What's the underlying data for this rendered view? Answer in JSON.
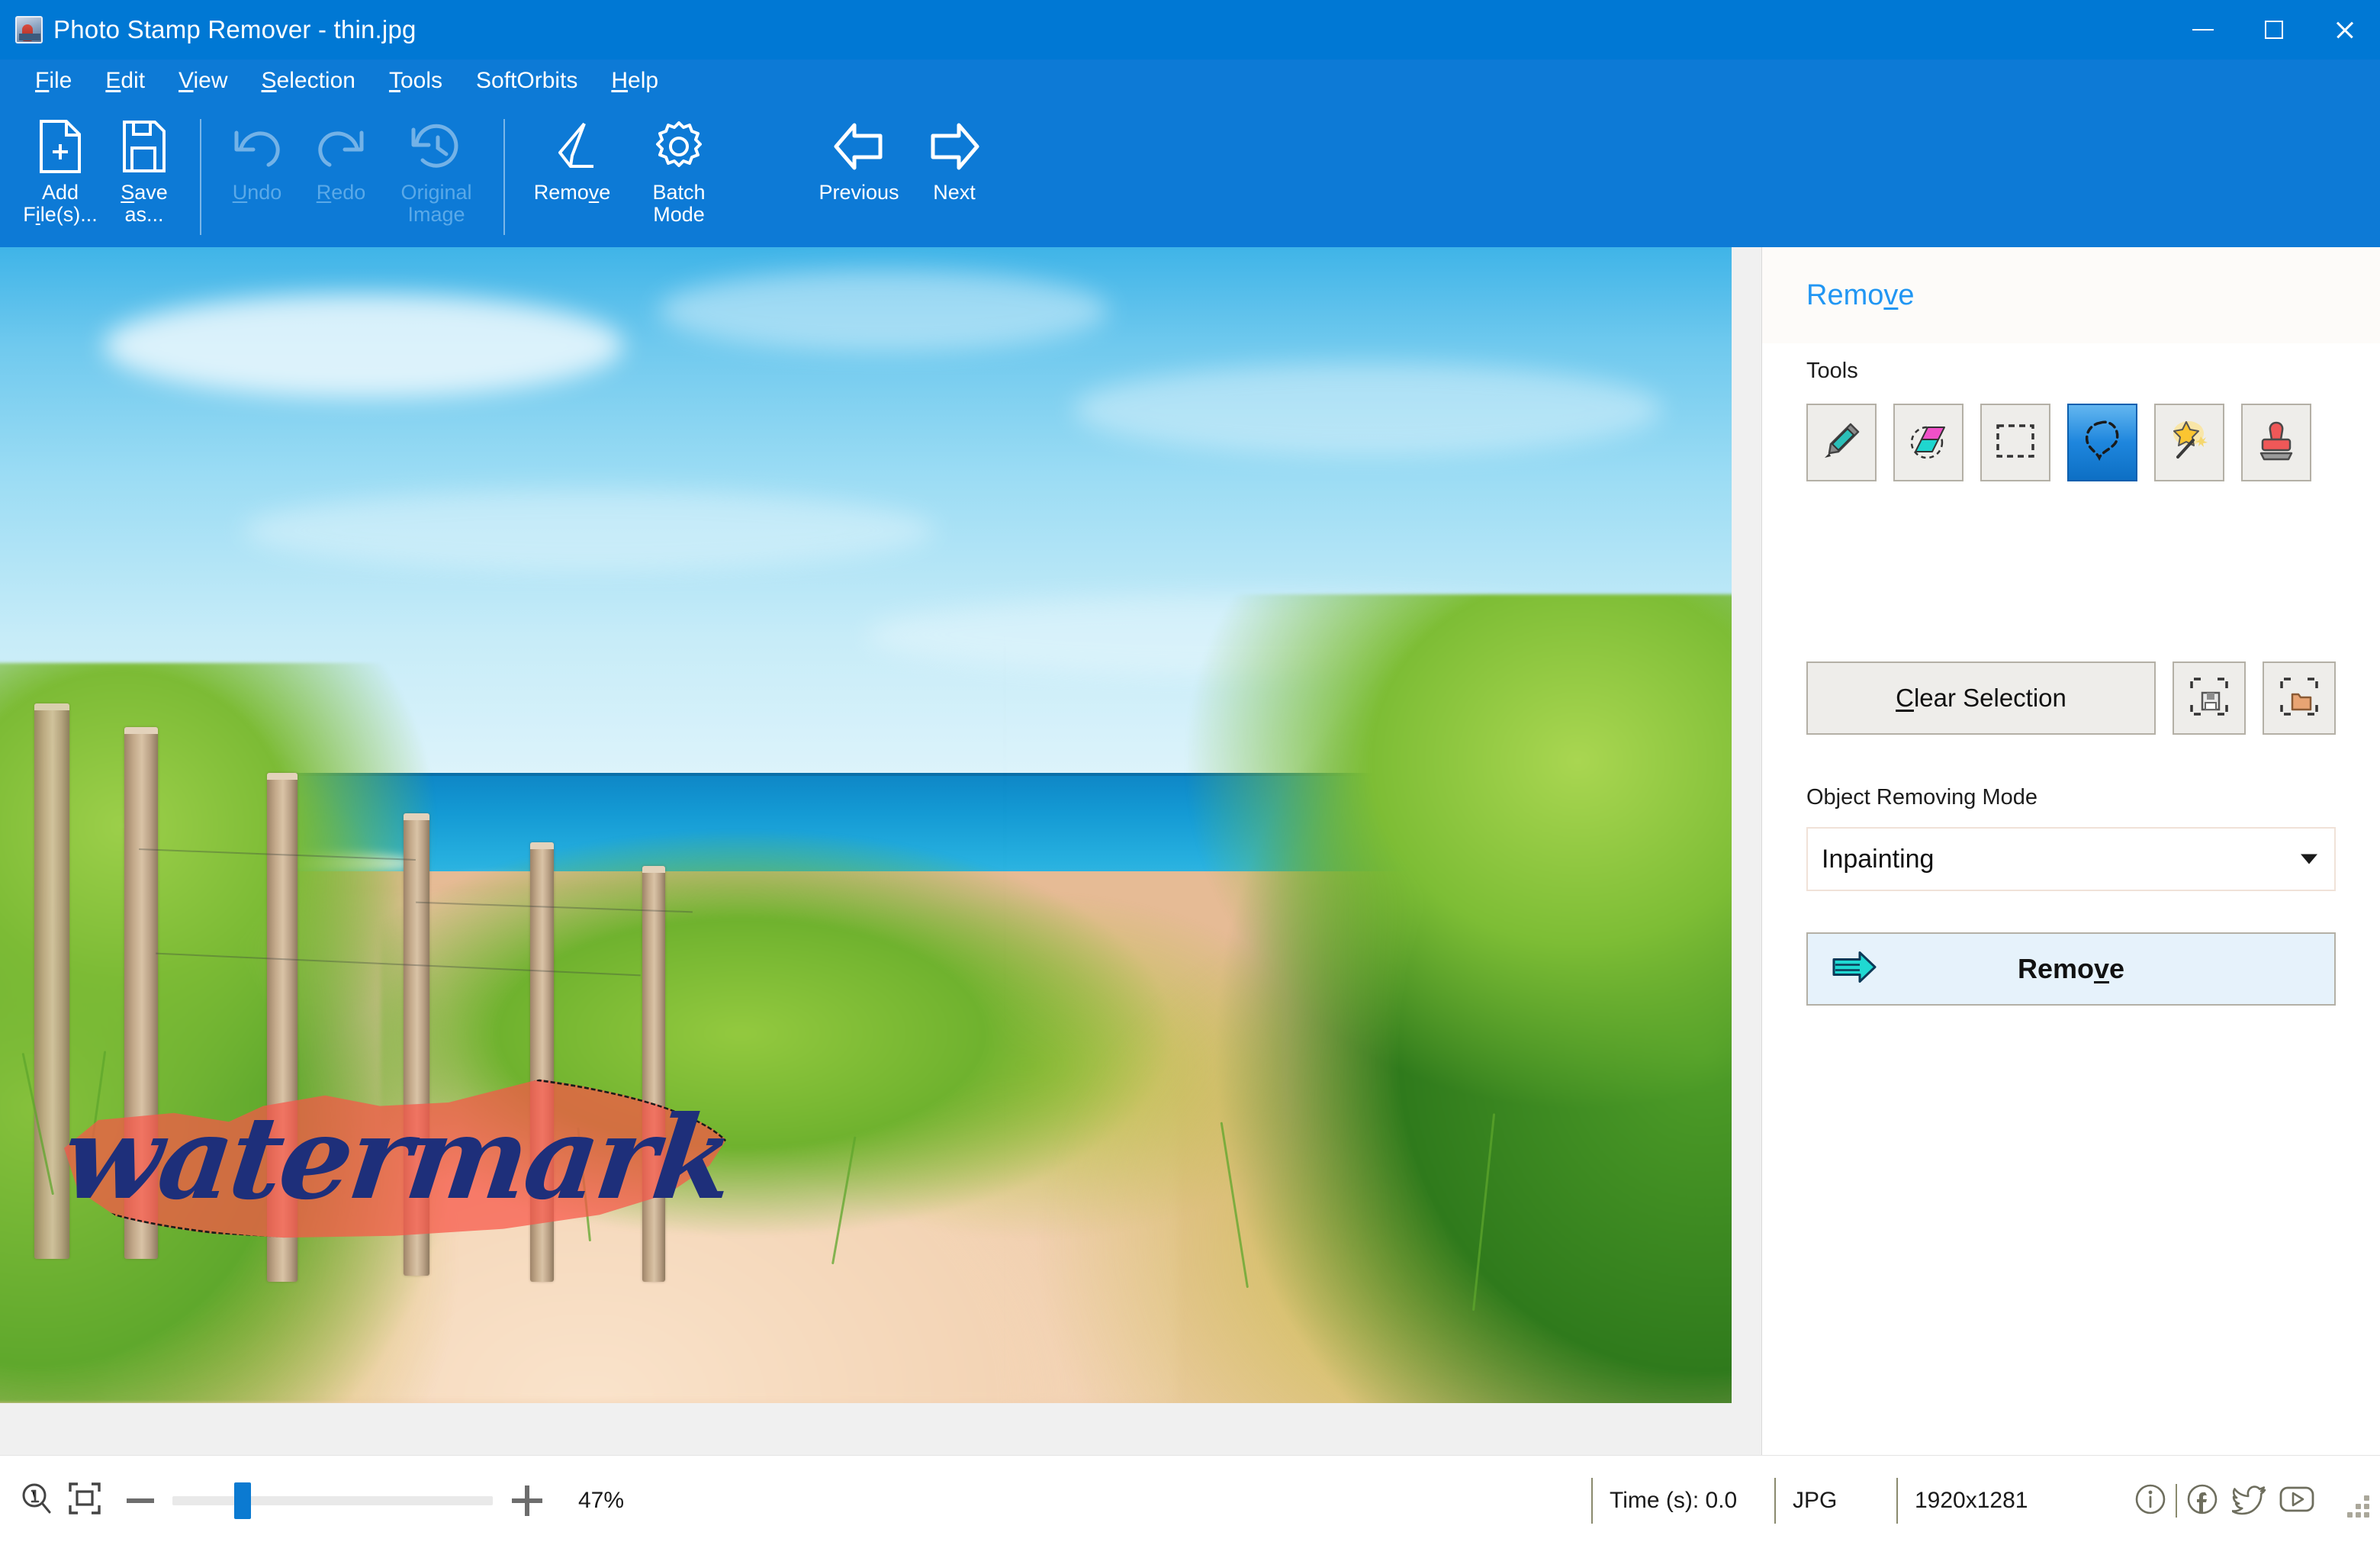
{
  "window": {
    "title": "Photo Stamp Remover - thin.jpg",
    "icon": "app-photo-icon",
    "controls": {
      "minimize": "minimize",
      "maximize": "maximize",
      "close": "close"
    }
  },
  "menu": {
    "items": [
      {
        "label": "File",
        "accel": "F"
      },
      {
        "label": "Edit",
        "accel": "E"
      },
      {
        "label": "View",
        "accel": "V"
      },
      {
        "label": "Selection",
        "accel": "S"
      },
      {
        "label": "Tools",
        "accel": "T"
      },
      {
        "label": "SoftOrbits",
        "accel": ""
      },
      {
        "label": "Help",
        "accel": "H"
      }
    ]
  },
  "toolbar": {
    "buttons": [
      {
        "id": "add-files",
        "label": "Add\nFile(s)...",
        "icon": "file-plus-icon",
        "enabled": true
      },
      {
        "id": "save-as",
        "label": "Save\nas...",
        "icon": "floppy-save-icon",
        "enabled": true
      },
      {
        "id": "undo",
        "label": "Undo",
        "icon": "undo-arrow-icon",
        "enabled": false
      },
      {
        "id": "redo",
        "label": "Redo",
        "icon": "redo-arrow-icon",
        "enabled": false
      },
      {
        "id": "original-image",
        "label": "Original\nImage",
        "icon": "history-clock-icon",
        "enabled": false
      },
      {
        "id": "remove",
        "label": "Remove",
        "icon": "eraser-icon",
        "enabled": true
      },
      {
        "id": "batch-mode",
        "label": "Batch\nMode",
        "icon": "gear-icon",
        "enabled": true
      },
      {
        "id": "previous",
        "label": "Previous",
        "icon": "arrow-left-icon",
        "enabled": true
      },
      {
        "id": "next",
        "label": "Next",
        "icon": "arrow-right-icon",
        "enabled": true
      }
    ]
  },
  "canvas": {
    "image_alt": "beach dune path with wooden fence posts, sea and dune grass",
    "watermark_text": "watermark",
    "selection_active": true
  },
  "panel": {
    "title": "Remove",
    "tools_label": "Tools",
    "tools": [
      {
        "id": "marker",
        "icon": "marker-pen-icon",
        "active": false
      },
      {
        "id": "eraser",
        "icon": "eraser-select-icon",
        "active": false
      },
      {
        "id": "rectangle",
        "icon": "rectangle-select-icon",
        "active": false
      },
      {
        "id": "lasso",
        "icon": "lasso-select-icon",
        "active": true
      },
      {
        "id": "magicwand",
        "icon": "magic-wand-icon",
        "active": false
      },
      {
        "id": "stamp",
        "icon": "clone-stamp-icon",
        "active": false
      }
    ],
    "clear_selection_label": "Clear Selection",
    "save_selection_icon": "save-selection-icon",
    "load_selection_icon": "load-selection-icon",
    "mode_label": "Object Removing Mode",
    "mode_value": "Inpainting",
    "mode_options": [
      "Inpainting"
    ],
    "remove_button_label": "Remove",
    "remove_button_icon": "arrow-right-thick-icon"
  },
  "statusbar": {
    "zoom_actual_icon": "zoom-actual-size-icon",
    "zoom_fit_icon": "zoom-fit-window-icon",
    "zoom_out_icon": "minus-icon",
    "zoom_in_icon": "plus-icon",
    "zoom_percent": "47%",
    "zoom_slider_value": 22,
    "time_label": "Time (s): 0.0",
    "format": "JPG",
    "dimensions": "1920x1281",
    "social": [
      {
        "id": "info",
        "icon": "info-circle-icon"
      },
      {
        "id": "facebook",
        "icon": "facebook-icon"
      },
      {
        "id": "twitter",
        "icon": "twitter-bird-icon"
      },
      {
        "id": "youtube",
        "icon": "youtube-play-icon"
      }
    ],
    "resize_grip_icon": "resize-grip-icon"
  },
  "colors": {
    "titlebar": "#0078d4",
    "menubar": "#0d7ad6",
    "accent": "#2196f3",
    "selection_overlay": "#f85648",
    "watermark": "#1e2f7a",
    "tool_active": "#1e86dd"
  }
}
